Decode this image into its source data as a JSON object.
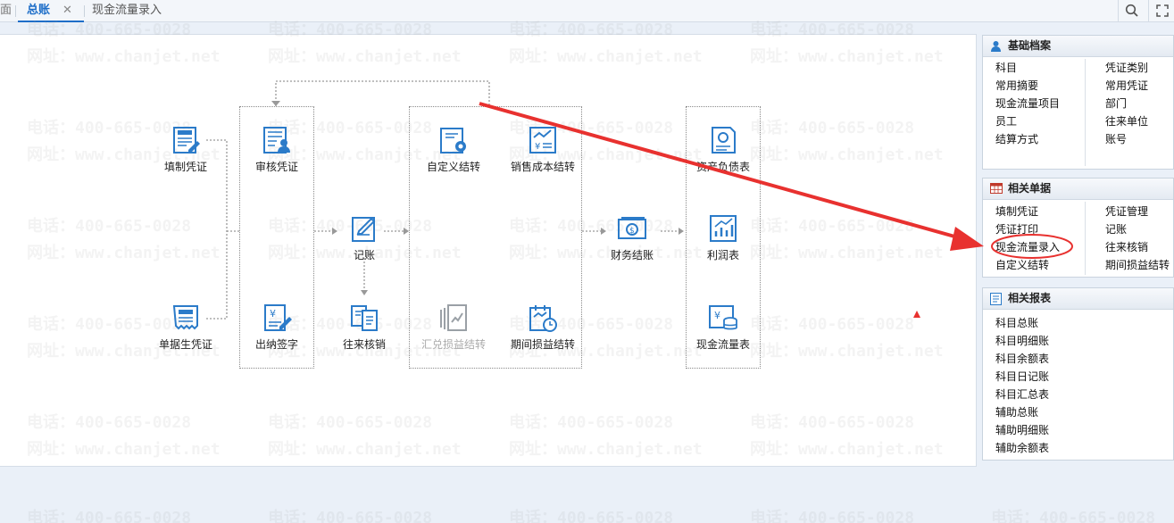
{
  "tabs": {
    "partial_label": "面",
    "active_label": "总账",
    "active_close": "✕",
    "second_label": "现金流量录入"
  },
  "toolbar": {
    "search_icon": "search-icon",
    "fullscreen_icon": "fullscreen-icon"
  },
  "flow": {
    "create_voucher": "填制凭证",
    "audit_voucher": "审核凭证",
    "doc_voucher": "单据生凭证",
    "cashier_sign": "出纳签字",
    "posting": "记账",
    "ar_ap_writeoff": "往来核销",
    "custom_transfer": "自定义结转",
    "sales_cost_transfer": "销售成本结转",
    "fx_gain_loss_transfer": "汇兑损益结转",
    "period_gain_loss_transfer": "期间损益结转",
    "financial_closing": "财务结账",
    "balance_sheet": "资产负债表",
    "income_statement": "利润表",
    "cash_flow_statement": "现金流量表"
  },
  "panels": {
    "basic": {
      "title": "基础档案",
      "left": [
        "科目",
        "常用摘要",
        "现金流量项目",
        "员工",
        "结算方式"
      ],
      "right": [
        "凭证类别",
        "常用凭证",
        "部门",
        "往来单位",
        "账号"
      ]
    },
    "related_docs": {
      "title": "相关单据",
      "left": [
        "填制凭证",
        "凭证打印",
        "现金流量录入",
        "自定义结转"
      ],
      "right": [
        "凭证管理",
        "记账",
        "往来核销",
        "期间损益结转"
      ]
    },
    "reports": {
      "title": "相关报表",
      "items": [
        "科目总账",
        "科目明细账",
        "科目余额表",
        "科目日记账",
        "科目汇总表",
        "辅助总账",
        "辅助明细账",
        "辅助余额表"
      ]
    }
  },
  "watermark": {
    "phone": "电话：400-665-0028",
    "site": "网址：www.chanjet.net"
  },
  "colors": {
    "accent": "#1e6ec8",
    "icon_blue": "#2b7bc9",
    "annotation_red": "#e8312f"
  }
}
